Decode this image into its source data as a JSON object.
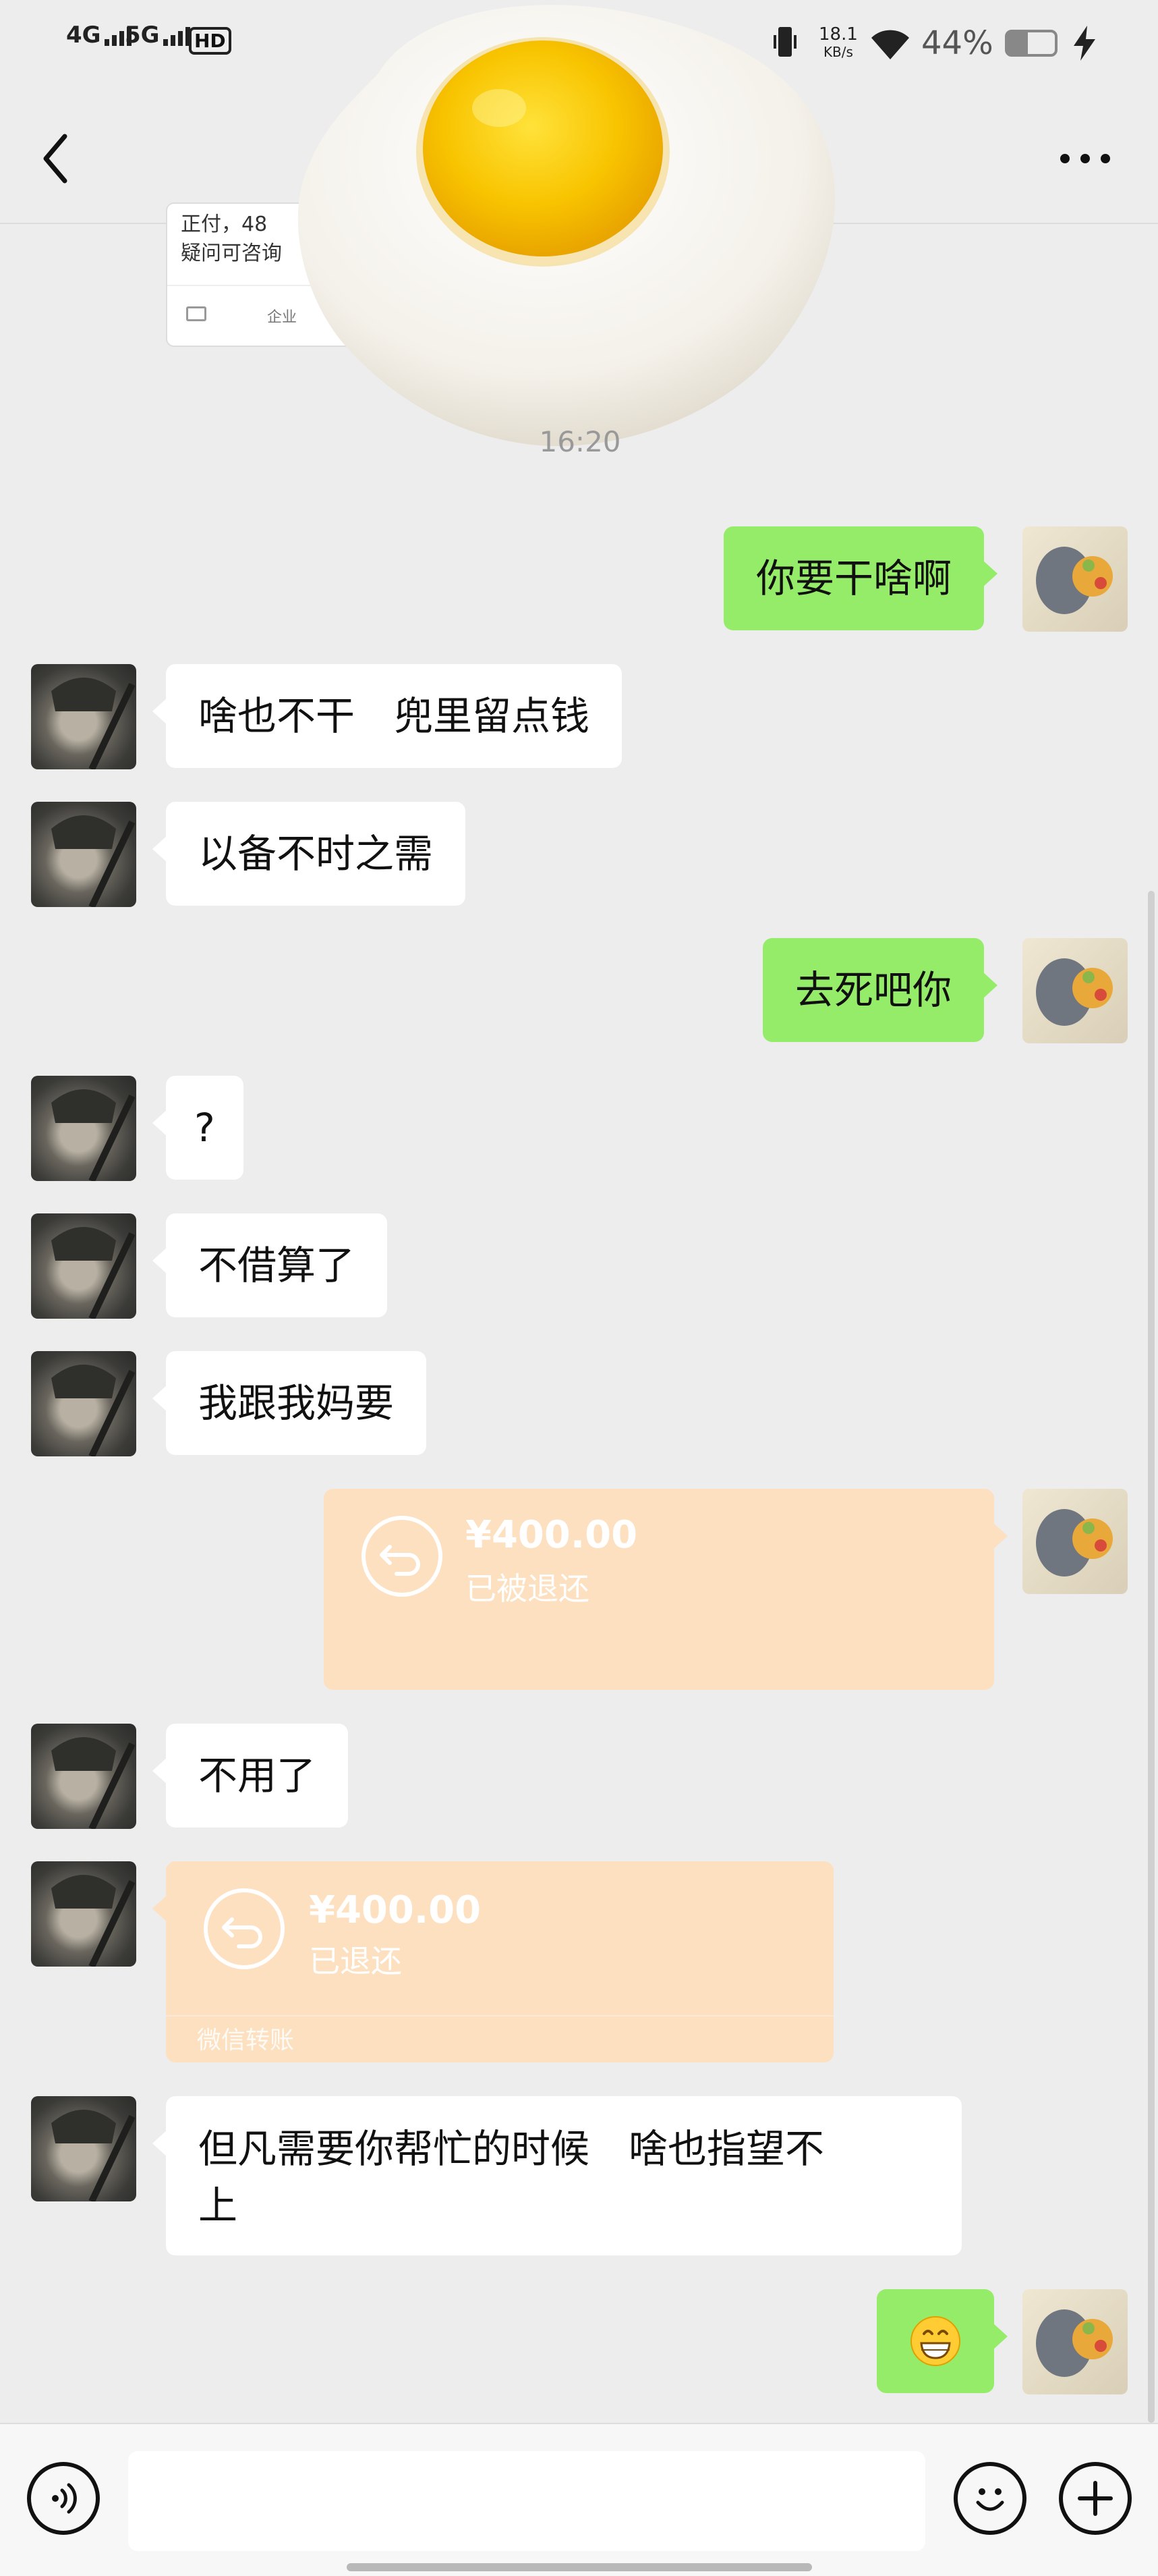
{
  "status_bar": {
    "net1": "4G",
    "net2": "5G",
    "hd": "HD",
    "speed_value": "18.1",
    "speed_unit": "KB/s",
    "battery": "44%"
  },
  "header": {
    "snippet_line1": "正付，48",
    "snippet_line2": "疑问可咨询",
    "snippet_footer": "企业"
  },
  "timestamp": "16:20",
  "messages": [
    {
      "side": "right",
      "type": "text",
      "text": "你要干啥啊"
    },
    {
      "side": "left",
      "type": "text",
      "text": "啥也不干　兜里留点钱"
    },
    {
      "side": "left",
      "type": "text",
      "text": "以备不时之需"
    },
    {
      "side": "right",
      "type": "text",
      "text": "去死吧你"
    },
    {
      "side": "left",
      "type": "text",
      "text": "?"
    },
    {
      "side": "left",
      "type": "text",
      "text": "不借算了"
    },
    {
      "side": "left",
      "type": "text",
      "text": "我跟我妈要"
    },
    {
      "side": "right",
      "type": "transfer",
      "amount": "¥400.00",
      "status": "已被退还"
    },
    {
      "side": "left",
      "type": "text",
      "text": "不用了"
    },
    {
      "side": "left",
      "type": "transfer",
      "amount": "¥400.00",
      "status": "已退还",
      "footer": "微信转账"
    },
    {
      "side": "left",
      "type": "text",
      "line1": "但凡需要你帮忙的时候　啥也指望不",
      "line2": "上"
    },
    {
      "side": "right",
      "type": "emoji",
      "icon": "grinning-face-emoji"
    }
  ],
  "colors": {
    "background": "#ededed",
    "self_bubble": "#95ec69",
    "friend_bubble": "#ffffff",
    "transfer": "#fde0c0"
  }
}
